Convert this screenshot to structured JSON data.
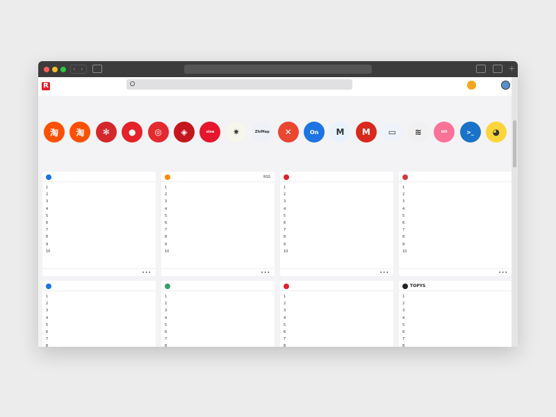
{
  "header": {
    "logo": "R",
    "site_name": "",
    "search_placeholder": "",
    "coin_count": ""
  },
  "nav": [
    {
      "label": "",
      "active": true
    },
    {
      "label": ""
    },
    {
      "label": ""
    },
    {
      "label": ""
    },
    {
      "label": ""
    },
    {
      "label": ""
    },
    {
      "label": ""
    },
    {
      "label": ""
    },
    {
      "label": ""
    },
    {
      "label": ""
    },
    {
      "label": ""
    },
    {
      "label": ""
    },
    {
      "label": ""
    }
  ],
  "section_label": "",
  "apps": [
    {
      "glyph": "淘",
      "color": "#ff5000",
      "name": "",
      "sub": ""
    },
    {
      "glyph": "淘",
      "color": "#ff5000",
      "name": "",
      "sub": ""
    },
    {
      "glyph": "✻",
      "color": "#d4282b",
      "name": "",
      "sub": ""
    },
    {
      "glyph": "●",
      "color": "#e62129",
      "name": "",
      "sub": ""
    },
    {
      "glyph": "◎",
      "color": "#e42a2f",
      "name": "",
      "sub": ""
    },
    {
      "glyph": "◈",
      "color": "#c4171d",
      "name": "",
      "sub": ""
    },
    {
      "glyph": "sina",
      "color": "#e6162d",
      "name": "",
      "sub": ""
    },
    {
      "glyph": "✷",
      "color": "#f6f6ec",
      "name": "",
      "sub": ""
    },
    {
      "glyph": "ZhiMap",
      "color": "#eef2f7",
      "name": "",
      "sub": ""
    },
    {
      "glyph": "✕",
      "color": "#ea4630",
      "name": "",
      "sub": ""
    },
    {
      "glyph": "On",
      "color": "#1d74e3",
      "name": "",
      "sub": ""
    },
    {
      "glyph": "M",
      "color": "#eaf2fb",
      "name": "",
      "sub": ""
    },
    {
      "glyph": "M",
      "color": "#da291c",
      "name": "",
      "sub": ""
    },
    {
      "glyph": "▭",
      "color": "#eef3fb",
      "name": "",
      "sub": ""
    },
    {
      "glyph": "≋",
      "color": "#f1f1f1",
      "name": "",
      "sub": ""
    },
    {
      "glyph": "bili",
      "color": "#fb7299",
      "name": "",
      "sub": ""
    },
    {
      "glyph": ">_",
      "color": "#1a73c8",
      "name": "",
      "sub": ""
    },
    {
      "glyph": "◕",
      "color": "#ffd43b",
      "name": "",
      "sub": ""
    }
  ],
  "sub_row": {
    "left": "",
    "links": [
      {
        "label": "",
        "hot": true
      },
      {
        "label": ""
      },
      {
        "label": ""
      },
      {
        "label": ""
      },
      {
        "label": ""
      },
      {
        "label": ""
      },
      {
        "label": ""
      },
      {
        "label": ""
      },
      {
        "label": ""
      }
    ]
  },
  "cards": [
    {
      "title": "",
      "badge": "#1a73e8",
      "right": "",
      "footer": "",
      "items": [
        {
          "n": "1",
          "t": "",
          "v": ""
        },
        {
          "n": "2",
          "t": "",
          "v": ""
        },
        {
          "n": "3",
          "t": "",
          "v": ""
        },
        {
          "n": "4",
          "t": "",
          "v": ""
        },
        {
          "n": "5",
          "t": "",
          "v": ""
        },
        {
          "n": "6",
          "t": "",
          "v": ""
        },
        {
          "n": "7",
          "t": "",
          "v": ""
        },
        {
          "n": "8",
          "t": "",
          "v": ""
        },
        {
          "n": "9",
          "t": "",
          "v": ""
        },
        {
          "n": "10",
          "t": "",
          "v": ""
        }
      ]
    },
    {
      "title": "",
      "badge": "#ff8a00",
      "right": "RSS",
      "footer": "",
      "items": [
        {
          "n": "1",
          "t": "",
          "v": ""
        },
        {
          "n": "2",
          "t": "",
          "v": ""
        },
        {
          "n": "3",
          "t": "",
          "v": ""
        },
        {
          "n": "4",
          "t": "",
          "v": ""
        },
        {
          "n": "5",
          "t": "",
          "v": ""
        },
        {
          "n": "6",
          "t": "",
          "v": ""
        },
        {
          "n": "7",
          "t": "",
          "v": ""
        },
        {
          "n": "8",
          "t": "",
          "v": ""
        },
        {
          "n": "9",
          "t": "",
          "v": ""
        },
        {
          "n": "10",
          "t": "",
          "v": ""
        }
      ]
    },
    {
      "title": "",
      "badge": "#e2202c",
      "right": "",
      "footer": "",
      "items": [
        {
          "n": "1",
          "t": "",
          "v": ""
        },
        {
          "n": "2",
          "t": "",
          "v": ""
        },
        {
          "n": "3",
          "t": "",
          "v": ""
        },
        {
          "n": "4",
          "t": "",
          "v": ""
        },
        {
          "n": "5",
          "t": "",
          "v": ""
        },
        {
          "n": "6",
          "t": "",
          "v": ""
        },
        {
          "n": "7",
          "t": "",
          "v": ""
        },
        {
          "n": "8",
          "t": "",
          "v": ""
        },
        {
          "n": "9",
          "t": "",
          "v": ""
        },
        {
          "n": "10",
          "t": "",
          "v": ""
        }
      ]
    },
    {
      "title": "",
      "badge": "#d7363b",
      "right": "",
      "footer": "",
      "items": [
        {
          "n": "1",
          "t": "",
          "v": ""
        },
        {
          "n": "2",
          "t": "",
          "v": ""
        },
        {
          "n": "3",
          "t": "",
          "v": ""
        },
        {
          "n": "4",
          "t": "",
          "v": ""
        },
        {
          "n": "5",
          "t": "",
          "v": ""
        },
        {
          "n": "6",
          "t": "",
          "v": ""
        },
        {
          "n": "7",
          "t": "",
          "v": ""
        },
        {
          "n": "8",
          "t": "",
          "v": ""
        },
        {
          "n": "9",
          "t": "",
          "v": ""
        },
        {
          "n": "10",
          "t": "",
          "v": ""
        }
      ]
    },
    {
      "title": "",
      "badge": "#1a73e8",
      "right": "",
      "footer": "",
      "items": [
        {
          "n": "1",
          "t": "",
          "v": ""
        },
        {
          "n": "2",
          "t": "",
          "v": ""
        },
        {
          "n": "3",
          "t": "",
          "v": ""
        },
        {
          "n": "4",
          "t": "",
          "v": ""
        },
        {
          "n": "5",
          "t": "",
          "v": ""
        },
        {
          "n": "6",
          "t": "",
          "v": ""
        },
        {
          "n": "7",
          "t": "",
          "v": ""
        },
        {
          "n": "8",
          "t": "",
          "v": ""
        }
      ]
    },
    {
      "title": "",
      "badge": "#38a169",
      "right": "",
      "footer": "",
      "items": [
        {
          "n": "1",
          "t": "",
          "v": ""
        },
        {
          "n": "2",
          "t": "",
          "v": ""
        },
        {
          "n": "3",
          "t": "",
          "v": ""
        },
        {
          "n": "4",
          "t": "",
          "v": ""
        },
        {
          "n": "5",
          "t": "",
          "v": ""
        },
        {
          "n": "6",
          "t": "",
          "v": ""
        },
        {
          "n": "7",
          "t": "",
          "v": ""
        },
        {
          "n": "8",
          "t": "",
          "v": ""
        }
      ]
    },
    {
      "title": "",
      "badge": "#e2202c",
      "right": "",
      "footer": "",
      "items": [
        {
          "n": "1",
          "t": "",
          "v": ""
        },
        {
          "n": "2",
          "t": "",
          "v": ""
        },
        {
          "n": "3",
          "t": "",
          "v": ""
        },
        {
          "n": "4",
          "t": "",
          "v": ""
        },
        {
          "n": "5",
          "t": "",
          "v": ""
        },
        {
          "n": "6",
          "t": "",
          "v": ""
        },
        {
          "n": "7",
          "t": "",
          "v": ""
        },
        {
          "n": "8",
          "t": "",
          "v": ""
        }
      ]
    },
    {
      "title": "TOPYS",
      "badge": "#222222",
      "right": "",
      "footer": "",
      "items": [
        {
          "n": "1",
          "t": "",
          "v": ""
        },
        {
          "n": "2",
          "t": "",
          "v": ""
        },
        {
          "n": "3",
          "t": "",
          "v": ""
        },
        {
          "n": "4",
          "t": "",
          "v": ""
        },
        {
          "n": "5",
          "t": "",
          "v": ""
        },
        {
          "n": "6",
          "t": "",
          "v": ""
        },
        {
          "n": "7",
          "t": "",
          "v": ""
        },
        {
          "n": "8",
          "t": "",
          "v": ""
        }
      ]
    }
  ]
}
